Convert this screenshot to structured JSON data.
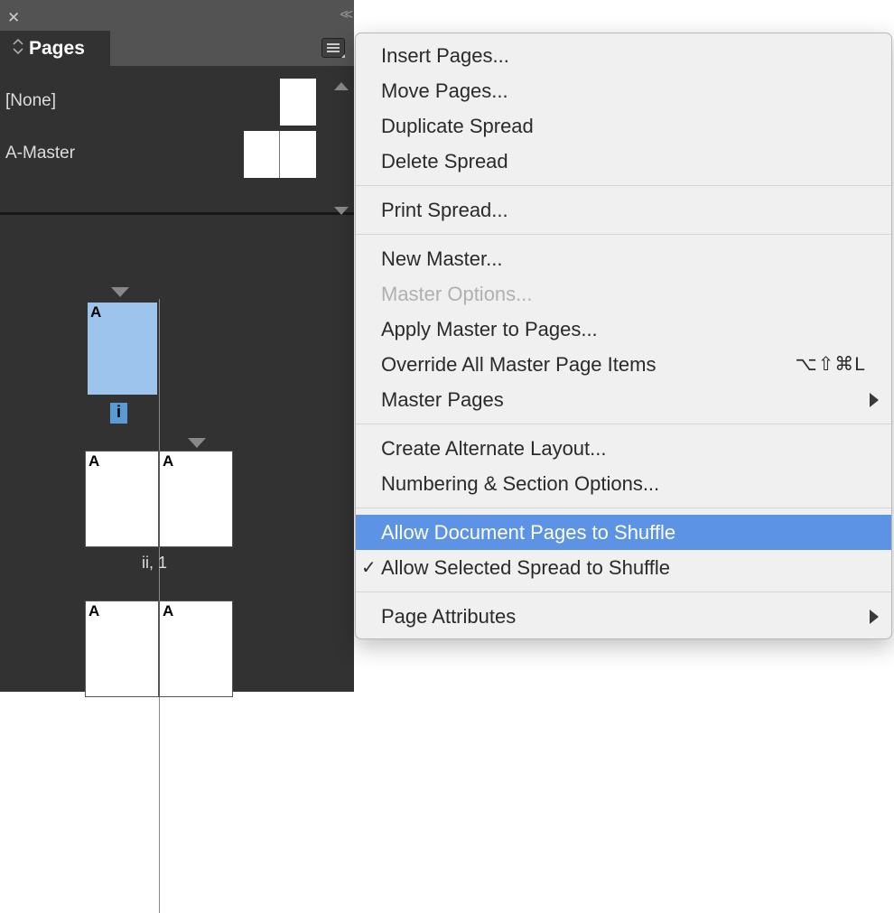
{
  "panel": {
    "title": "Pages",
    "masters": [
      {
        "label": "[None]"
      },
      {
        "label": "A-Master"
      }
    ],
    "spreads": {
      "page1": {
        "letter": "A",
        "label": "i"
      },
      "page2": {
        "letterL": "A",
        "letterR": "A",
        "label": "ii, 1"
      },
      "page3": {
        "letterL": "A",
        "letterR": "A"
      }
    }
  },
  "menu": {
    "items": [
      {
        "label": "Insert Pages..."
      },
      {
        "label": "Move Pages..."
      },
      {
        "label": "Duplicate Spread"
      },
      {
        "label": "Delete Spread"
      }
    ],
    "group2": [
      {
        "label": "Print Spread..."
      }
    ],
    "group3": [
      {
        "label": "New Master..."
      },
      {
        "label": "Master Options...",
        "disabled": true
      },
      {
        "label": "Apply Master to Pages..."
      },
      {
        "label": "Override All Master Page Items",
        "shortcut": "⌥⇧⌘L"
      },
      {
        "label": "Master Pages",
        "submenu": true
      }
    ],
    "group4": [
      {
        "label": "Create Alternate Layout..."
      },
      {
        "label": "Numbering & Section Options..."
      }
    ],
    "group5": [
      {
        "label": "Allow Document Pages to Shuffle",
        "highlighted": true
      },
      {
        "label": "Allow Selected Spread to Shuffle",
        "checked": true
      }
    ],
    "group6": [
      {
        "label": "Page Attributes",
        "submenu": true
      }
    ]
  }
}
